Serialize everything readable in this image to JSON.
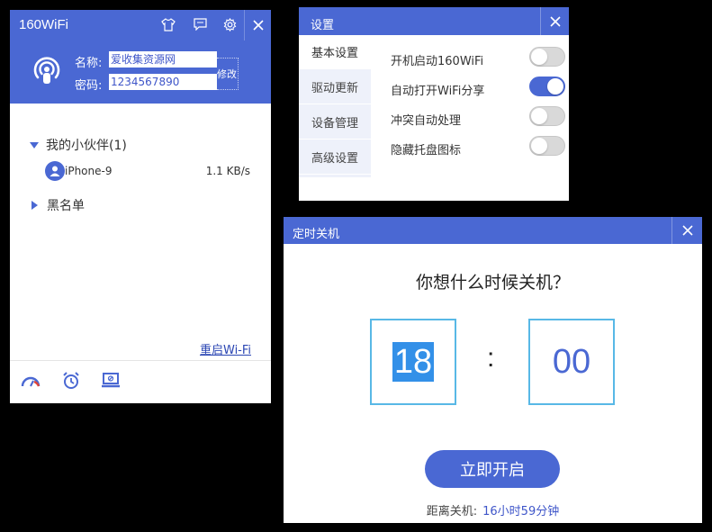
{
  "main_window": {
    "title": "160WiFi",
    "name_label": "名称:",
    "name_value": "爱收集资源网",
    "password_label": "密码:",
    "password_value": "1234567890",
    "edit_label": "修改",
    "partner_group_label": "我的小伙伴(1)",
    "devices": [
      {
        "name": "iPhone-9",
        "speed": "1.1 KB/s"
      }
    ],
    "blacklist_label": "黑名单",
    "restart_wifi_label": "重启Wi-Fi",
    "footer_icons": [
      "speedometer-icon",
      "alarm-clock-icon",
      "laptop-icon"
    ]
  },
  "settings_window": {
    "title": "设置",
    "tabs": [
      {
        "label": "基本设置",
        "active": true
      },
      {
        "label": "驱动更新",
        "active": false
      },
      {
        "label": "设备管理",
        "active": false
      },
      {
        "label": "高级设置",
        "active": false
      }
    ],
    "options": [
      {
        "label": "开机启动160WiFi",
        "enabled": false
      },
      {
        "label": "自动打开WiFi分享",
        "enabled": true
      },
      {
        "label": "冲突自动处理",
        "enabled": false
      },
      {
        "label": "隐藏托盘图标",
        "enabled": false
      }
    ]
  },
  "timer_window": {
    "title": "定时关机",
    "question": "你想什么时候关机？",
    "hour": "18",
    "separator": ":",
    "minute": "00",
    "start_button_label": "立即开启",
    "remaining_label": "距离关机:",
    "remaining_value": "16小时59分钟"
  },
  "colors": {
    "accent": "#4a68d3",
    "box_border": "#58b8e6",
    "selection": "#3390e8",
    "link": "#2b46b3"
  }
}
